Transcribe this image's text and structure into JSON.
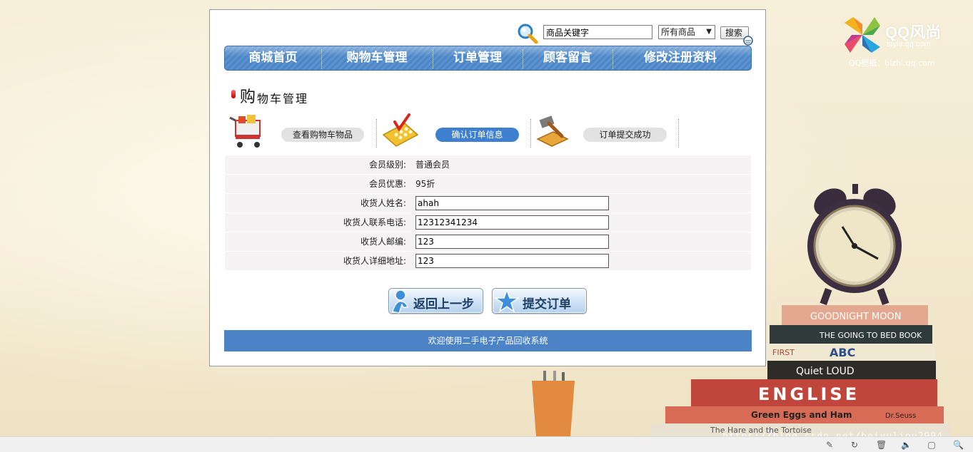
{
  "brand": {
    "title": "QQ风尚",
    "url": "style.qq.com",
    "subtitle": "QQ壁纸：bizhi.qq.com"
  },
  "decor": {
    "book_titles": [
      "GOODNIGHT MOON",
      "THE GOING TO BED BOOK",
      "FIRST",
      "ABC",
      "Quiet LOUD",
      "ENGLISE",
      "Green Eggs and Ham",
      "Dr.Seuss",
      "The Hare and the Tortoise"
    ],
    "watermark": "https://blog.csdn.net/beiyuliou2994"
  },
  "search": {
    "placeholder": "商品关键字",
    "value": "商品关键字",
    "category_selected": "所有商品",
    "button_label": "搜索"
  },
  "nav": {
    "items": [
      {
        "label": "商城首页"
      },
      {
        "label": "购物车管理"
      },
      {
        "label": "订单管理"
      },
      {
        "label": "顾客留言"
      },
      {
        "label": "修改注册资料"
      }
    ]
  },
  "page": {
    "title_first_char": "购",
    "title_rest": "物车管理"
  },
  "steps": [
    {
      "label": "查看购物车物品",
      "active": false,
      "icon": "shopping-cart-icon"
    },
    {
      "label": "确认订单信息",
      "active": true,
      "icon": "calculator-icon"
    },
    {
      "label": "订单提交成功",
      "active": false,
      "icon": "gavel-icon"
    }
  ],
  "form": {
    "member_level": {
      "label": "会员级别:",
      "value": "普通会员"
    },
    "member_discount": {
      "label": "会员优惠:",
      "value": "95折"
    },
    "receiver_name": {
      "label": "收货人姓名:",
      "value": "ahah"
    },
    "receiver_phone": {
      "label": "收货人联系电话:",
      "value": "12312341234"
    },
    "receiver_zip": {
      "label": "收货人邮编:",
      "value": "123"
    },
    "receiver_address": {
      "label": "收货人详细地址:",
      "value": "123"
    }
  },
  "actions": {
    "back_label": "返回上一步",
    "submit_label": "提交订单"
  },
  "footer": {
    "text": "欢迎使用二手电子产品回收系统"
  },
  "colors": {
    "nav_blue": "#4d86c6",
    "active_step": "#3f7fcf",
    "footer_blue": "#4c83c7"
  }
}
